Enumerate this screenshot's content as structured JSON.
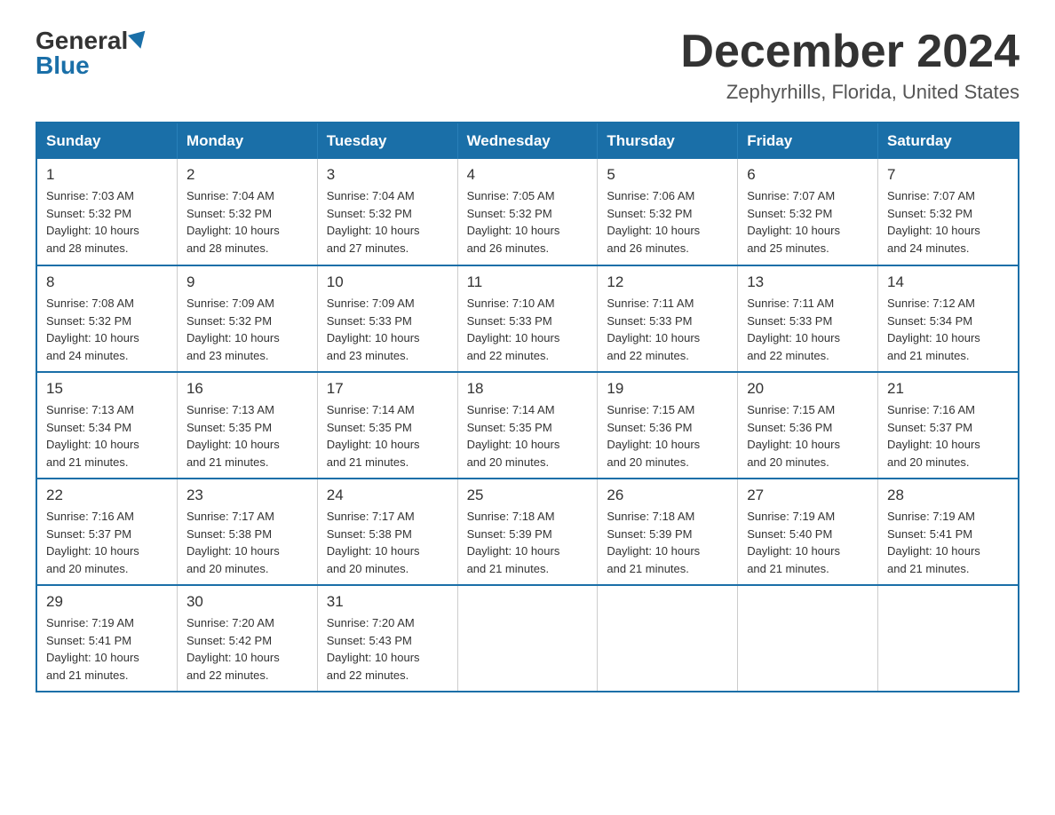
{
  "logo": {
    "general": "General",
    "blue": "Blue"
  },
  "title": "December 2024",
  "subtitle": "Zephyrhills, Florida, United States",
  "days_of_week": [
    "Sunday",
    "Monday",
    "Tuesday",
    "Wednesday",
    "Thursday",
    "Friday",
    "Saturday"
  ],
  "weeks": [
    [
      {
        "day": "1",
        "info": "Sunrise: 7:03 AM\nSunset: 5:32 PM\nDaylight: 10 hours\nand 28 minutes."
      },
      {
        "day": "2",
        "info": "Sunrise: 7:04 AM\nSunset: 5:32 PM\nDaylight: 10 hours\nand 28 minutes."
      },
      {
        "day": "3",
        "info": "Sunrise: 7:04 AM\nSunset: 5:32 PM\nDaylight: 10 hours\nand 27 minutes."
      },
      {
        "day": "4",
        "info": "Sunrise: 7:05 AM\nSunset: 5:32 PM\nDaylight: 10 hours\nand 26 minutes."
      },
      {
        "day": "5",
        "info": "Sunrise: 7:06 AM\nSunset: 5:32 PM\nDaylight: 10 hours\nand 26 minutes."
      },
      {
        "day": "6",
        "info": "Sunrise: 7:07 AM\nSunset: 5:32 PM\nDaylight: 10 hours\nand 25 minutes."
      },
      {
        "day": "7",
        "info": "Sunrise: 7:07 AM\nSunset: 5:32 PM\nDaylight: 10 hours\nand 24 minutes."
      }
    ],
    [
      {
        "day": "8",
        "info": "Sunrise: 7:08 AM\nSunset: 5:32 PM\nDaylight: 10 hours\nand 24 minutes."
      },
      {
        "day": "9",
        "info": "Sunrise: 7:09 AM\nSunset: 5:32 PM\nDaylight: 10 hours\nand 23 minutes."
      },
      {
        "day": "10",
        "info": "Sunrise: 7:09 AM\nSunset: 5:33 PM\nDaylight: 10 hours\nand 23 minutes."
      },
      {
        "day": "11",
        "info": "Sunrise: 7:10 AM\nSunset: 5:33 PM\nDaylight: 10 hours\nand 22 minutes."
      },
      {
        "day": "12",
        "info": "Sunrise: 7:11 AM\nSunset: 5:33 PM\nDaylight: 10 hours\nand 22 minutes."
      },
      {
        "day": "13",
        "info": "Sunrise: 7:11 AM\nSunset: 5:33 PM\nDaylight: 10 hours\nand 22 minutes."
      },
      {
        "day": "14",
        "info": "Sunrise: 7:12 AM\nSunset: 5:34 PM\nDaylight: 10 hours\nand 21 minutes."
      }
    ],
    [
      {
        "day": "15",
        "info": "Sunrise: 7:13 AM\nSunset: 5:34 PM\nDaylight: 10 hours\nand 21 minutes."
      },
      {
        "day": "16",
        "info": "Sunrise: 7:13 AM\nSunset: 5:35 PM\nDaylight: 10 hours\nand 21 minutes."
      },
      {
        "day": "17",
        "info": "Sunrise: 7:14 AM\nSunset: 5:35 PM\nDaylight: 10 hours\nand 21 minutes."
      },
      {
        "day": "18",
        "info": "Sunrise: 7:14 AM\nSunset: 5:35 PM\nDaylight: 10 hours\nand 20 minutes."
      },
      {
        "day": "19",
        "info": "Sunrise: 7:15 AM\nSunset: 5:36 PM\nDaylight: 10 hours\nand 20 minutes."
      },
      {
        "day": "20",
        "info": "Sunrise: 7:15 AM\nSunset: 5:36 PM\nDaylight: 10 hours\nand 20 minutes."
      },
      {
        "day": "21",
        "info": "Sunrise: 7:16 AM\nSunset: 5:37 PM\nDaylight: 10 hours\nand 20 minutes."
      }
    ],
    [
      {
        "day": "22",
        "info": "Sunrise: 7:16 AM\nSunset: 5:37 PM\nDaylight: 10 hours\nand 20 minutes."
      },
      {
        "day": "23",
        "info": "Sunrise: 7:17 AM\nSunset: 5:38 PM\nDaylight: 10 hours\nand 20 minutes."
      },
      {
        "day": "24",
        "info": "Sunrise: 7:17 AM\nSunset: 5:38 PM\nDaylight: 10 hours\nand 20 minutes."
      },
      {
        "day": "25",
        "info": "Sunrise: 7:18 AM\nSunset: 5:39 PM\nDaylight: 10 hours\nand 21 minutes."
      },
      {
        "day": "26",
        "info": "Sunrise: 7:18 AM\nSunset: 5:39 PM\nDaylight: 10 hours\nand 21 minutes."
      },
      {
        "day": "27",
        "info": "Sunrise: 7:19 AM\nSunset: 5:40 PM\nDaylight: 10 hours\nand 21 minutes."
      },
      {
        "day": "28",
        "info": "Sunrise: 7:19 AM\nSunset: 5:41 PM\nDaylight: 10 hours\nand 21 minutes."
      }
    ],
    [
      {
        "day": "29",
        "info": "Sunrise: 7:19 AM\nSunset: 5:41 PM\nDaylight: 10 hours\nand 21 minutes."
      },
      {
        "day": "30",
        "info": "Sunrise: 7:20 AM\nSunset: 5:42 PM\nDaylight: 10 hours\nand 22 minutes."
      },
      {
        "day": "31",
        "info": "Sunrise: 7:20 AM\nSunset: 5:43 PM\nDaylight: 10 hours\nand 22 minutes."
      },
      {
        "day": "",
        "info": ""
      },
      {
        "day": "",
        "info": ""
      },
      {
        "day": "",
        "info": ""
      },
      {
        "day": "",
        "info": ""
      }
    ]
  ],
  "colors": {
    "header_bg": "#1a6fa8",
    "header_text": "#ffffff",
    "border": "#1a6fa8"
  }
}
